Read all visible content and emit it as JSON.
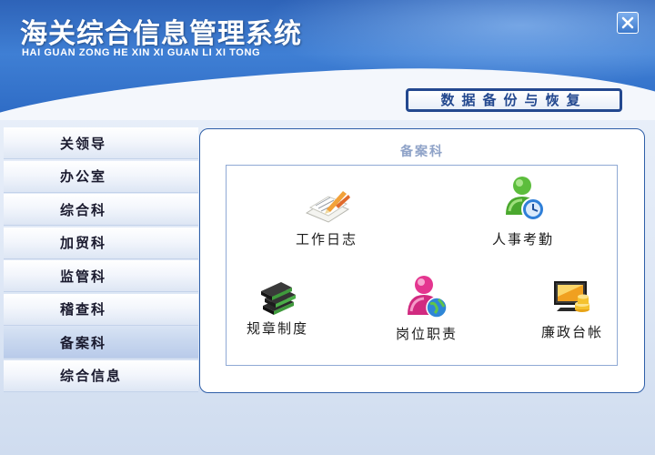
{
  "header": {
    "title": "海关综合信息管理系统",
    "subtitle": "HAI GUAN ZONG HE XIN XI GUAN LI XI TONG",
    "close_icon": "close-icon"
  },
  "toolbar": {
    "backup_label": "数据备份与恢复"
  },
  "sidebar": {
    "items": [
      {
        "label": "关领导"
      },
      {
        "label": "办公室"
      },
      {
        "label": "综合科"
      },
      {
        "label": "加贸科"
      },
      {
        "label": "监管科"
      },
      {
        "label": "稽查科"
      },
      {
        "label": "备案科"
      },
      {
        "label": "综合信息"
      }
    ],
    "active": "备案科"
  },
  "panel": {
    "title": "备案科",
    "modules": [
      {
        "label": "工作日志",
        "icon": "notepad-pencil-icon"
      },
      {
        "label": "人事考勤",
        "icon": "user-clock-icon"
      },
      {
        "label": "规章制度",
        "icon": "books-icon"
      },
      {
        "label": "岗位职责",
        "icon": "user-globe-icon"
      },
      {
        "label": "廉政台帐",
        "icon": "monitor-coins-icon"
      }
    ]
  },
  "colors": {
    "header_blue": "#2e63b8",
    "button_border": "#23488f",
    "panel_title": "#8fa3c8"
  }
}
